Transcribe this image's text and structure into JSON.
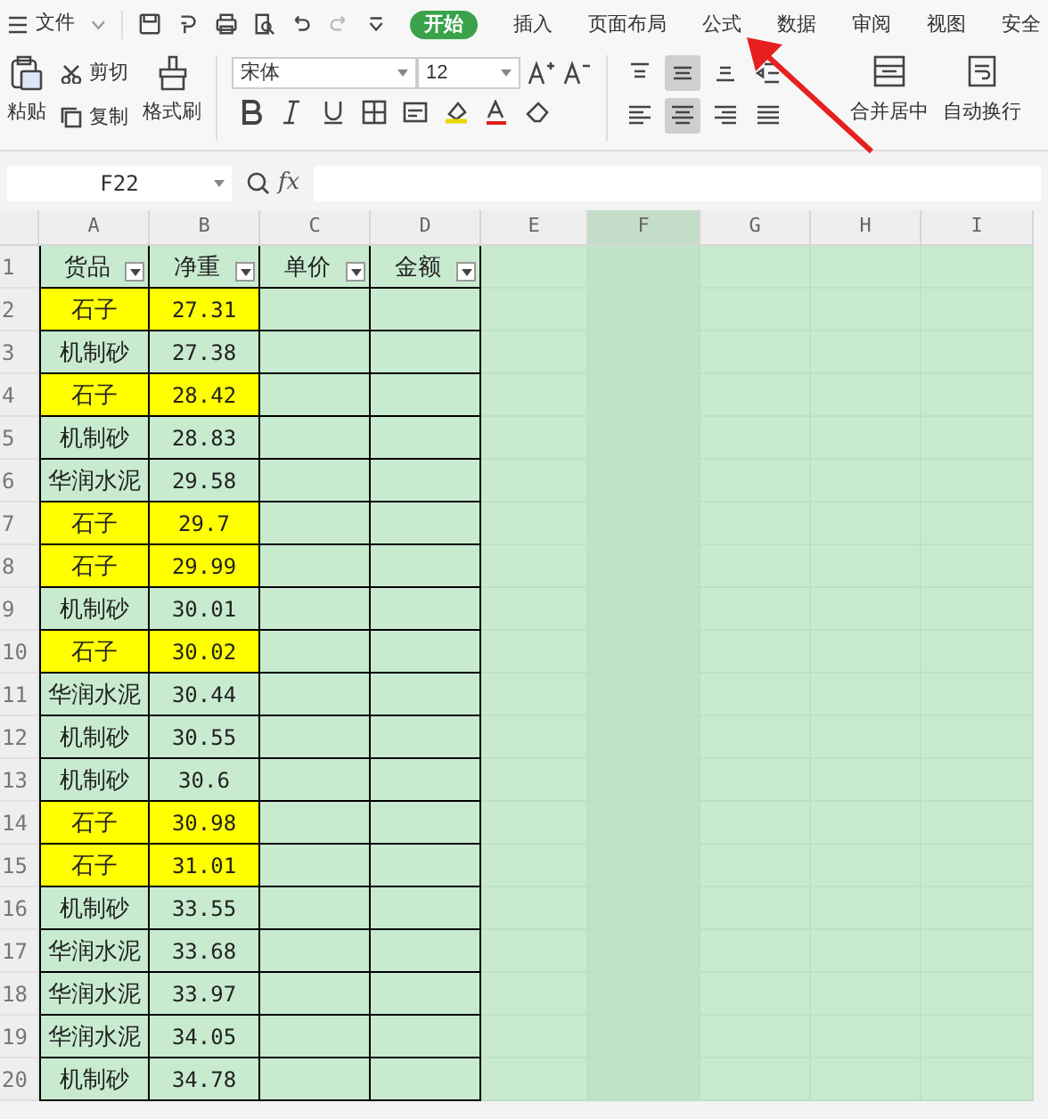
{
  "menu_bar": {
    "file_label": "文件",
    "tabs": [
      {
        "label": "开始",
        "selected": true
      },
      {
        "label": "插入",
        "selected": false
      },
      {
        "label": "页面布局",
        "selected": false
      },
      {
        "label": "公式",
        "selected": false
      },
      {
        "label": "数据",
        "selected": false
      },
      {
        "label": "审阅",
        "selected": false
      },
      {
        "label": "视图",
        "selected": false
      },
      {
        "label": "安全",
        "selected": false
      }
    ]
  },
  "ribbon": {
    "paste": "粘贴",
    "cut": "剪切",
    "copy": "复制",
    "format_painter": "格式刷",
    "font": "宋体",
    "font_size": "12",
    "merge": "合并居中",
    "wrap": "自动换行",
    "align_buttons": [
      {
        "selected": false
      },
      {
        "selected": true
      },
      {
        "selected": false
      },
      {
        "selected": false
      },
      {
        "selected": false
      },
      {
        "selected": true
      },
      {
        "selected": false
      },
      {
        "selected": false
      }
    ]
  },
  "formula_bar": {
    "cell_ref": "F22",
    "fx": "fx"
  },
  "sheet": {
    "columns": [
      {
        "label": "A",
        "selected": false
      },
      {
        "label": "B",
        "selected": false
      },
      {
        "label": "C",
        "selected": false
      },
      {
        "label": "D",
        "selected": false
      },
      {
        "label": "E",
        "selected": false
      },
      {
        "label": "F",
        "selected": true
      },
      {
        "label": "G",
        "selected": false
      },
      {
        "label": "H",
        "selected": false
      },
      {
        "label": "I",
        "selected": false
      }
    ],
    "headers": [
      "货品",
      "净重",
      "单价",
      "金额"
    ],
    "rows": [
      {
        "num": "2",
        "item": "石子",
        "weight": "27.31",
        "highlighted": true
      },
      {
        "num": "3",
        "item": "机制砂",
        "weight": "27.38",
        "highlighted": false
      },
      {
        "num": "4",
        "item": "石子",
        "weight": "28.42",
        "highlighted": true
      },
      {
        "num": "5",
        "item": "机制砂",
        "weight": "28.83",
        "highlighted": false
      },
      {
        "num": "6",
        "item": "华润水泥",
        "weight": "29.58",
        "highlighted": false
      },
      {
        "num": "7",
        "item": "石子",
        "weight": "29.7",
        "highlighted": true
      },
      {
        "num": "8",
        "item": "石子",
        "weight": "29.99",
        "highlighted": true
      },
      {
        "num": "9",
        "item": "机制砂",
        "weight": "30.01",
        "highlighted": false
      },
      {
        "num": "10",
        "item": "石子",
        "weight": "30.02",
        "highlighted": true
      },
      {
        "num": "11",
        "item": "华润水泥",
        "weight": "30.44",
        "highlighted": false
      },
      {
        "num": "12",
        "item": "机制砂",
        "weight": "30.55",
        "highlighted": false
      },
      {
        "num": "13",
        "item": "机制砂",
        "weight": "30.6",
        "highlighted": false
      },
      {
        "num": "14",
        "item": "石子",
        "weight": "30.98",
        "highlighted": true
      },
      {
        "num": "15",
        "item": "石子",
        "weight": "31.01",
        "highlighted": true
      },
      {
        "num": "16",
        "item": "机制砂",
        "weight": "33.55",
        "highlighted": false
      },
      {
        "num": "17",
        "item": "华润水泥",
        "weight": "33.68",
        "highlighted": false
      },
      {
        "num": "18",
        "item": "华润水泥",
        "weight": "33.97",
        "highlighted": false
      },
      {
        "num": "19",
        "item": "华润水泥",
        "weight": "34.05",
        "highlighted": false
      },
      {
        "num": "20",
        "item": "机制砂",
        "weight": "34.78",
        "highlighted": false
      }
    ],
    "header_row_num": "1"
  }
}
